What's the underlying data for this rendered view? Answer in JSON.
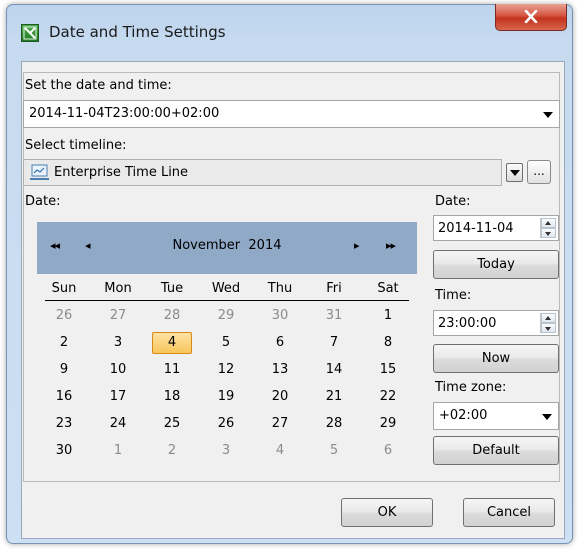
{
  "window": {
    "title": "Date and Time Settings"
  },
  "datetime": {
    "label": "Set the date and time:",
    "value": "2014-11-04T23:00:00+02:00"
  },
  "timeline": {
    "label": "Select timeline:",
    "value": "Enterprise Time Line",
    "more_label": "..."
  },
  "calendar": {
    "label": "Date:",
    "month": "November",
    "year": "2014",
    "nav_prev_year": "◂◂",
    "nav_prev_month": "◂",
    "nav_next_month": "▸",
    "nav_next_year": "▸▸",
    "weekdays": [
      "Sun",
      "Mon",
      "Tue",
      "Wed",
      "Thu",
      "Fri",
      "Sat"
    ],
    "weeks": [
      [
        "26",
        "27",
        "28",
        "29",
        "30",
        "31",
        "1"
      ],
      [
        "2",
        "3",
        "4",
        "5",
        "6",
        "7",
        "8"
      ],
      [
        "9",
        "10",
        "11",
        "12",
        "13",
        "14",
        "15"
      ],
      [
        "16",
        "17",
        "18",
        "19",
        "20",
        "21",
        "22"
      ],
      [
        "23",
        "24",
        "25",
        "26",
        "27",
        "28",
        "29"
      ],
      [
        "30",
        "1",
        "2",
        "3",
        "4",
        "5",
        "6"
      ]
    ],
    "selected_day": "4"
  },
  "side": {
    "date_label": "Date:",
    "date_value": "2014-11-04",
    "today_button": "Today",
    "time_label": "Time:",
    "time_value": "23:00:00",
    "now_button": "Now",
    "timezone_label": "Time zone:",
    "timezone_value": "+02:00",
    "default_button": "Default"
  },
  "footer": {
    "ok": "OK",
    "cancel": "Cancel"
  },
  "colors": {
    "calendar_header": "#8fa9c6",
    "selected_day_fill": "#f8c65a",
    "close_button": "#c2321e"
  }
}
